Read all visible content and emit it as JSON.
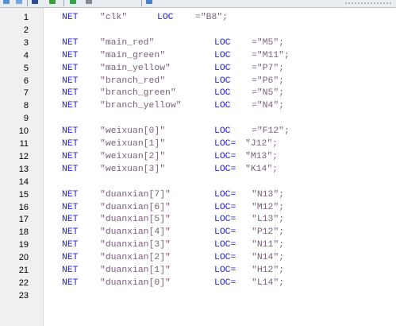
{
  "toolbar": {
    "icons": [
      "undo-icon",
      "redo-icon",
      "run-icon",
      "check-icon",
      "info-icon"
    ],
    "colors": {
      "background": "#e9ecf1",
      "border": "#b9c1cc"
    }
  },
  "editor": {
    "colors": {
      "keyword": "#1f1fd6",
      "string": "#7a5f7a",
      "plain": "#000000",
      "gutter": "#f0f0f0"
    },
    "lines": [
      {
        "num": "1",
        "kw": "NET",
        "sig": "\"clk\"",
        "loc": "LOC",
        "val": "=\"B8\";"
      },
      {
        "num": "2"
      },
      {
        "num": "3",
        "kw": "NET",
        "sig": "\"main_red\"",
        "loc": "LOC",
        "val": "=\"M5\";"
      },
      {
        "num": "4",
        "kw": "NET",
        "sig": "\"main_green\"",
        "loc": "LOC",
        "val": "=\"M11\";"
      },
      {
        "num": "5",
        "kw": "NET",
        "sig": "\"main_yellow\"",
        "loc": "LOC",
        "val": "=\"P7\";"
      },
      {
        "num": "6",
        "kw": "NET",
        "sig": "\"branch_red\"",
        "loc": "LOC",
        "val": "=\"P6\";"
      },
      {
        "num": "7",
        "kw": "NET",
        "sig": "\"branch_green\"",
        "loc": "LOC",
        "val": "=\"N5\";"
      },
      {
        "num": "8",
        "kw": "NET",
        "sig": "\"branch_yellow\"",
        "loc": "LOC",
        "val": "=\"N4\";"
      },
      {
        "num": "9"
      },
      {
        "num": "10",
        "kw": "NET",
        "sig": "\"weixuan[0]\"",
        "loc": "LOC",
        "val": "=\"F12\";"
      },
      {
        "num": "11",
        "kw": "NET",
        "sig": "\"weixuan[1]\"",
        "loc": "LOC=",
        "val": "\"J12\";"
      },
      {
        "num": "12",
        "kw": "NET",
        "sig": "\"weixuan[2]\"",
        "loc": "LOC=",
        "val": "\"M13\";"
      },
      {
        "num": "13",
        "kw": "NET",
        "sig": "\"weixuan[3]\"",
        "loc": "LOC=",
        "val": "\"K14\";"
      },
      {
        "num": "14"
      },
      {
        "num": "15",
        "kw": "NET",
        "sig": "\"duanxian[7]\"",
        "loc": "LOC=",
        "val": "\"N13\";"
      },
      {
        "num": "16",
        "kw": "NET",
        "sig": "\"duanxian[6]\"",
        "loc": "LOC=",
        "val": "\"M12\";"
      },
      {
        "num": "17",
        "kw": "NET",
        "sig": "\"duanxian[5]\"",
        "loc": "LOC=",
        "val": "\"L13\";"
      },
      {
        "num": "18",
        "kw": "NET",
        "sig": "\"duanxian[4]\"",
        "loc": "LOC=",
        "val": "\"P12\";"
      },
      {
        "num": "19",
        "kw": "NET",
        "sig": "\"duanxian[3]\"",
        "loc": "LOC=",
        "val": "\"N11\";"
      },
      {
        "num": "20",
        "kw": "NET",
        "sig": "\"duanxian[2]\"",
        "loc": "LOC=",
        "val": "\"N14\";"
      },
      {
        "num": "21",
        "kw": "NET",
        "sig": "\"duanxian[1]\"",
        "loc": "LOC=",
        "val": "\"H12\";"
      },
      {
        "num": "22",
        "kw": "NET",
        "sig": "\"duanxian[0]\"",
        "loc": "LOC=",
        "val": "\"L14\";"
      },
      {
        "num": "23"
      }
    ]
  }
}
